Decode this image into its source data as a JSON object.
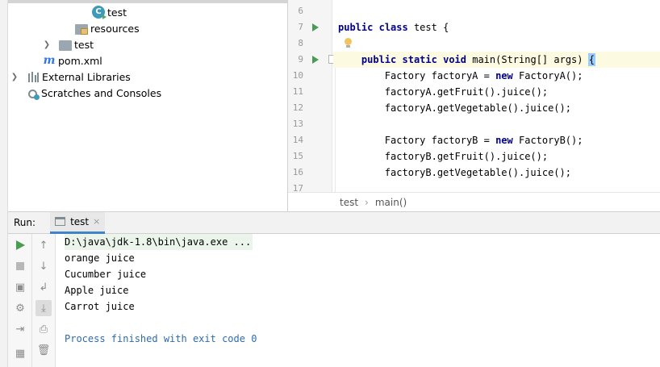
{
  "project_tree": {
    "items": [
      {
        "label": "test",
        "icon": "class-icon"
      },
      {
        "label": "resources",
        "icon": "resources-folder-icon"
      },
      {
        "label": "test",
        "icon": "folder-icon"
      },
      {
        "label": "pom.xml",
        "icon": "maven-icon"
      },
      {
        "label": "External Libraries",
        "icon": "library-icon"
      },
      {
        "label": "Scratches and Consoles",
        "icon": "scratch-icon"
      }
    ]
  },
  "editor": {
    "lines": [
      {
        "no": "6",
        "text": ""
      },
      {
        "no": "7",
        "text": "public class test {"
      },
      {
        "no": "8",
        "text": ""
      },
      {
        "no": "9",
        "text": "    public static void main(String[] args) {"
      },
      {
        "no": "10",
        "text": "        Factory factoryA = new FactoryA();"
      },
      {
        "no": "11",
        "text": "        factoryA.getFruit().juice();"
      },
      {
        "no": "12",
        "text": "        factoryA.getVegetable().juice();"
      },
      {
        "no": "13",
        "text": ""
      },
      {
        "no": "14",
        "text": "        Factory factoryB = new FactoryB();"
      },
      {
        "no": "15",
        "text": "        factoryB.getFruit().juice();"
      },
      {
        "no": "16",
        "text": "        factoryB.getVegetable().juice();"
      },
      {
        "no": "17",
        "text": ""
      }
    ],
    "breadcrumbs": [
      "test",
      "main()"
    ]
  },
  "run_window": {
    "label": "Run:",
    "tab": "test",
    "close_glyph": "×",
    "output": [
      "D:\\java\\jdk-1.8\\bin\\java.exe ...",
      "orange juice",
      "Cucumber juice",
      "Apple juice",
      "Carrot juice",
      "",
      "Process finished with exit code 0"
    ]
  },
  "colors": {
    "keyword": "#00008b",
    "run_green": "#499c54",
    "finish_text": "#2c6bb0",
    "tab_underline": "#4083c9"
  }
}
